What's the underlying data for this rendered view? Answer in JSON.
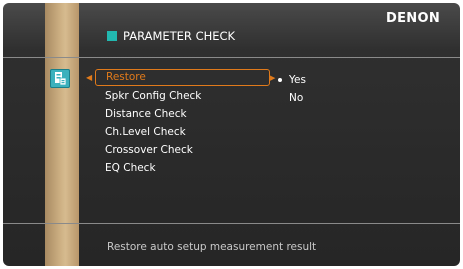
{
  "brand": "DENON",
  "title": "PARAMETER CHECK",
  "colors": {
    "accent": "#e07a1b",
    "title_marker": "#22b8b0",
    "icon": "#3bb1bd",
    "panel": "#2a2a2a"
  },
  "menu": {
    "items": [
      {
        "label": "Restore",
        "selected": true
      },
      {
        "label": "Spkr Config Check",
        "selected": false
      },
      {
        "label": "Distance Check",
        "selected": false
      },
      {
        "label": "Ch.Level Check",
        "selected": false
      },
      {
        "label": "Crossover Check",
        "selected": false
      },
      {
        "label": "EQ Check",
        "selected": false
      }
    ]
  },
  "options": [
    {
      "label": "Yes",
      "selected": true
    },
    {
      "label": "No",
      "selected": false
    }
  ],
  "status_text": "Restore auto setup measurement result",
  "icons": {
    "setup": "setup-icon",
    "left_arrow": "arrow-left-icon",
    "right_arrow": "arrow-right-icon"
  }
}
